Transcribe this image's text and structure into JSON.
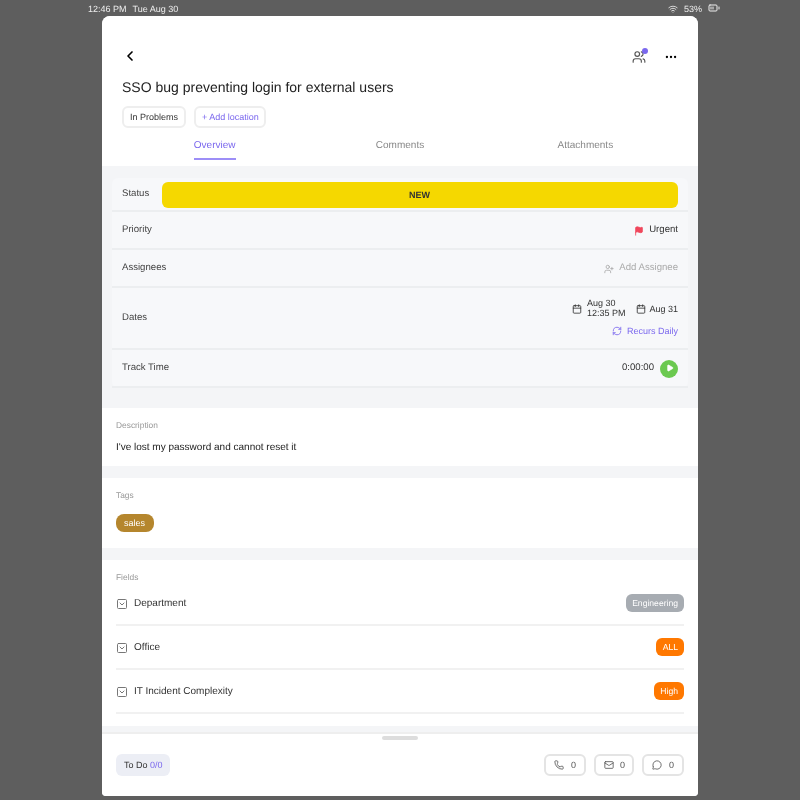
{
  "status_bar": {
    "time": "12:46 PM",
    "date": "Tue Aug 30",
    "battery": "53%"
  },
  "task": {
    "title": "SSO bug preventing login for external users",
    "location": "In Problems",
    "add_location": "+ Add location"
  },
  "tabs": [
    {
      "label": "Overview",
      "selected": true
    },
    {
      "label": "Comments",
      "selected": false
    },
    {
      "label": "Attachments",
      "selected": false
    }
  ],
  "properties": {
    "status": {
      "label": "Status",
      "value": "NEW",
      "color": "#f5d800"
    },
    "priority": {
      "label": "Priority",
      "value": "Urgent",
      "color": "#f0475c"
    },
    "assignees": {
      "label": "Assignees",
      "action": "Add Assignee"
    },
    "dates": {
      "label": "Dates",
      "start_date": "Aug 30",
      "start_time": "12:35 PM",
      "due_date": "Aug 31",
      "recurrence": "Recurs Daily"
    },
    "track_time": {
      "label": "Track Time",
      "value": "0:00:00"
    }
  },
  "description": {
    "label": "Description",
    "text": "I've lost my password and cannot reset it"
  },
  "tags": {
    "label": "Tags",
    "items": [
      {
        "label": "sales",
        "color": "#b5862d"
      }
    ]
  },
  "fields": {
    "label": "Fields",
    "items": [
      {
        "name": "Department",
        "value": "Engineering",
        "color": "#a7acb2"
      },
      {
        "name": "Office",
        "value": "ALL",
        "color": "#ff7800"
      },
      {
        "name": "IT Incident Complexity",
        "value": "High",
        "color": "#ff7800"
      }
    ]
  },
  "footer": {
    "status": "To Do",
    "count": "0/0",
    "counters": [
      {
        "kind": "phone",
        "value": "0"
      },
      {
        "kind": "mail",
        "value": "0"
      },
      {
        "kind": "chat",
        "value": "0"
      }
    ]
  }
}
